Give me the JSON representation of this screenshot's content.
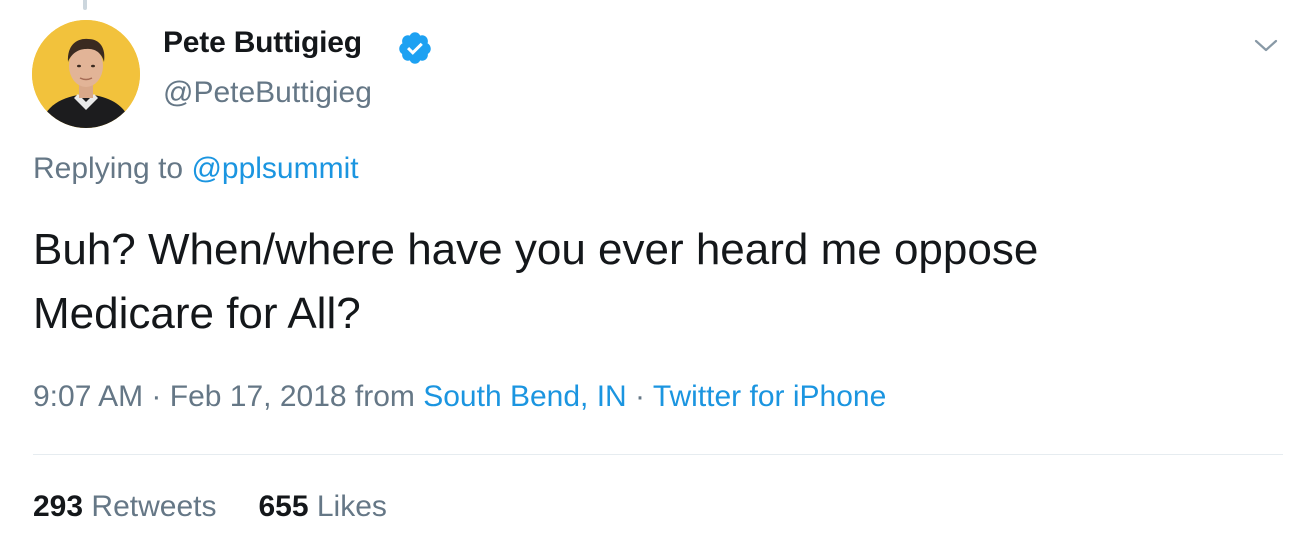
{
  "author": {
    "name": "Pete Buttigieg",
    "handle": "@PeteButtigieg",
    "verified": true
  },
  "reply": {
    "prefix": "Replying to",
    "handle": "@pplsummit"
  },
  "tweet": {
    "line1": "Buh? When/where have you ever heard me oppose",
    "line2": "Medicare for All?"
  },
  "meta": {
    "time": "9:07 AM",
    "sep1": " · ",
    "date": "Feb 17, 2018",
    "from": " from ",
    "location": "South Bend, IN",
    "sep2": " · ",
    "source": "Twitter for iPhone"
  },
  "stats": {
    "retweets_count": "293",
    "retweets_label": "Retweets",
    "likes_count": "655",
    "likes_label": "Likes"
  },
  "colors": {
    "link": "#1b95e0",
    "secondary_text": "#657786",
    "primary_text": "#14171a",
    "verified_badge": "#1da1f2",
    "avatar_background": "#f2c23c"
  },
  "icons": {
    "verified": "verified-badge-icon",
    "caret": "chevron-down-icon"
  }
}
